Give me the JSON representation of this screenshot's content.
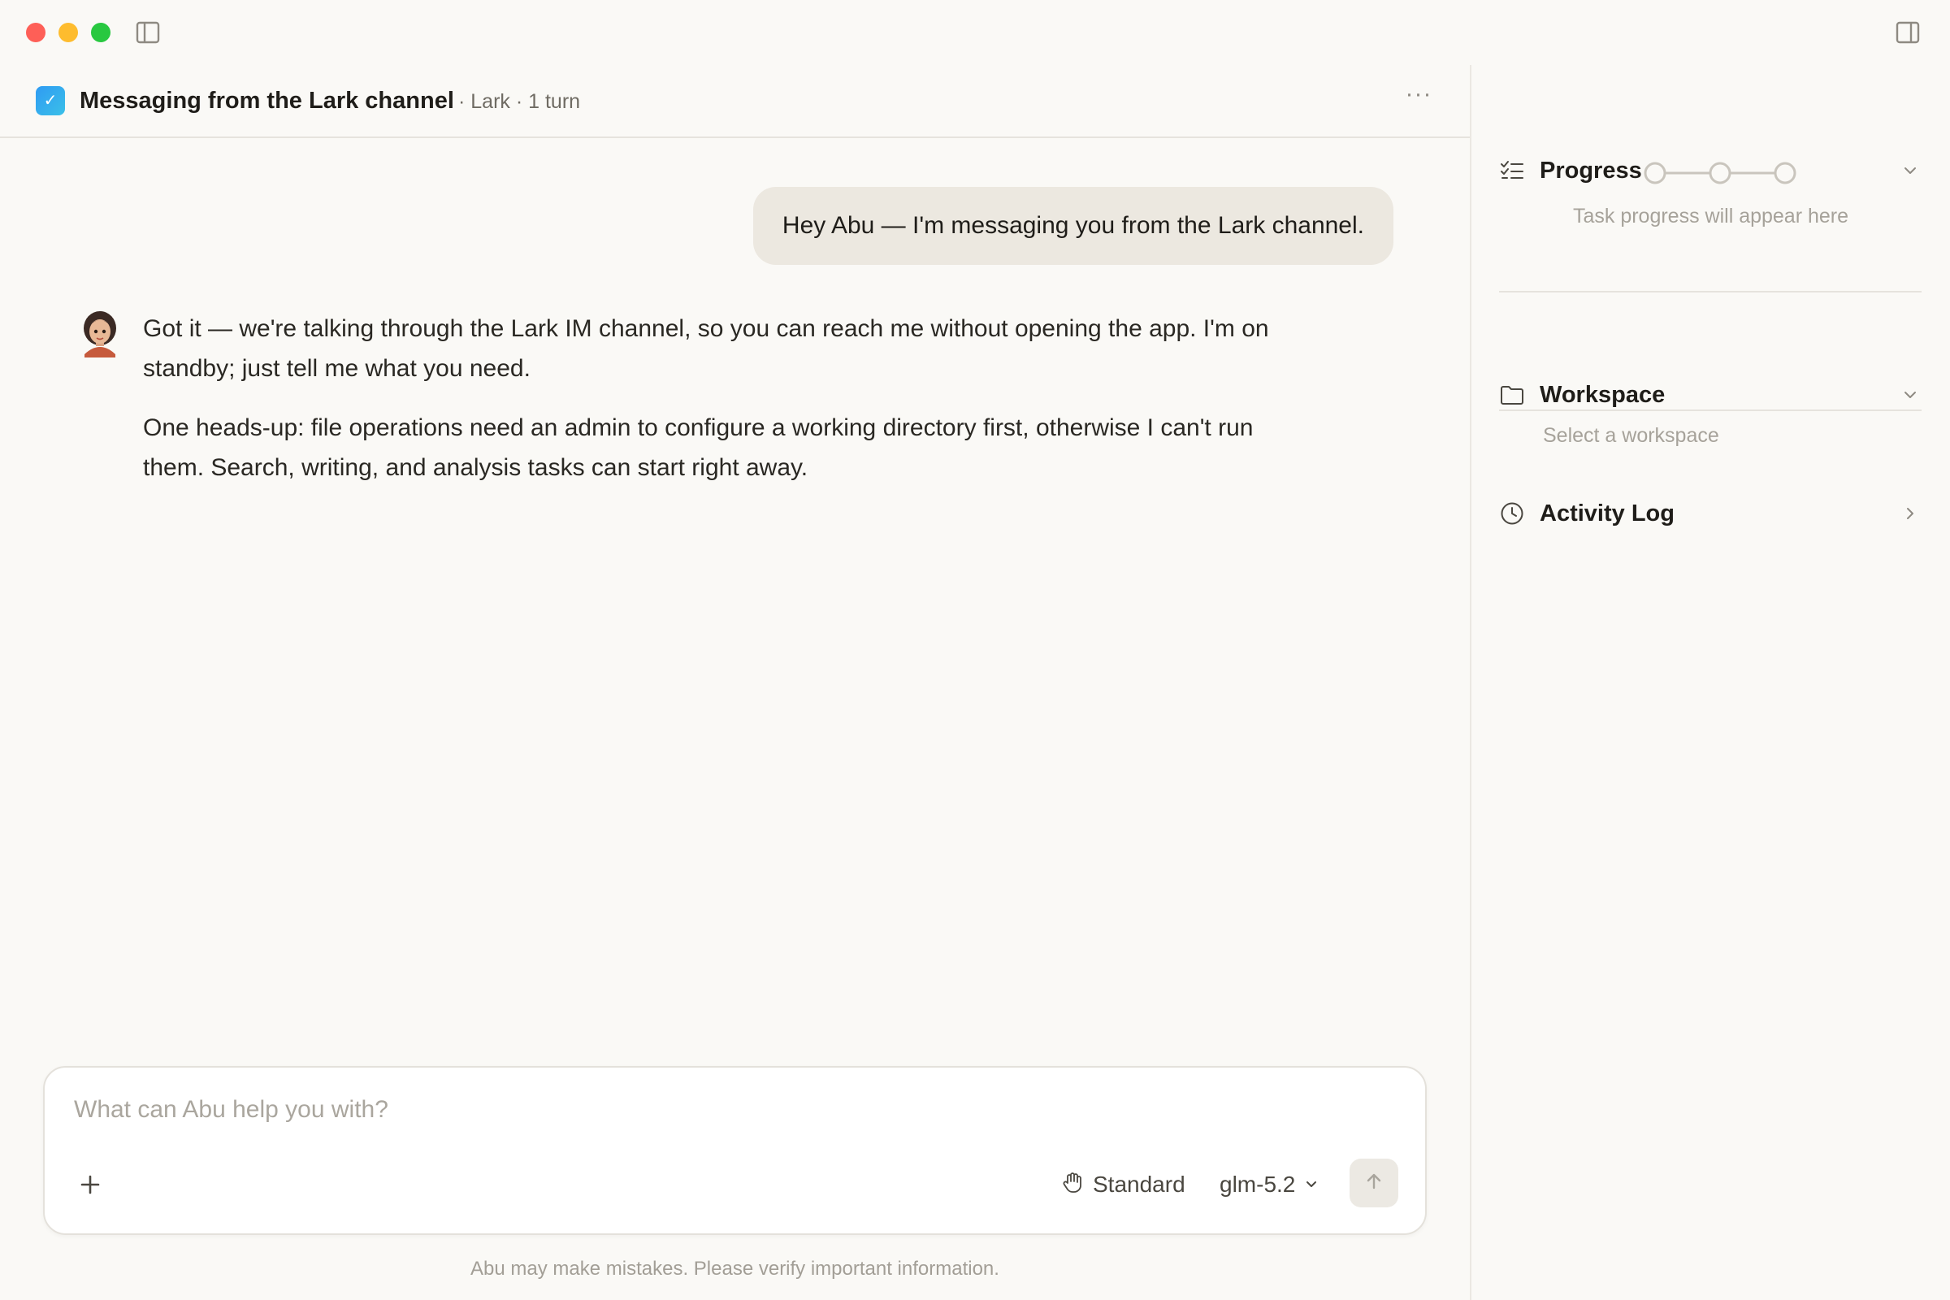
{
  "conversation": {
    "title": "Messaging from the Lark channel",
    "meta": "· Lark · 1 turn",
    "more": "···"
  },
  "messages": {
    "user": "Hey Abu — I'm messaging you from the Lark channel.",
    "assistant_p1": "Got it — we're talking through the Lark IM channel, so you can reach me without opening the app. I'm on standby; just tell me what you need.",
    "assistant_p2": "One heads-up: file operations need an admin to configure a working directory first, otherwise I can't run them. Search, writing, and analysis tasks can start right away."
  },
  "composer": {
    "placeholder": "What can Abu help you with?",
    "mode_label": "Standard",
    "model_label": "glm-5.2"
  },
  "disclaimer": "Abu may make mistakes. Please verify important information.",
  "right_panel": {
    "progress_title": "Progress",
    "progress_empty": "Task progress will appear here",
    "workspace_title": "Workspace",
    "workspace_placeholder": "Select a workspace",
    "activity_title": "Activity Log"
  },
  "icons": {
    "window_controls": [
      "close",
      "minimize",
      "zoom"
    ],
    "sidebar_toggle": "sidebar-left-icon",
    "panel_toggle": "sidebar-right-icon",
    "app": "lark-app-icon",
    "avatar": "assistant-avatar"
  },
  "colors": {
    "background": "#faf9f6",
    "user_bubble": "#ece8e0",
    "close": "#fe5f57",
    "minimize": "#febc2e",
    "zoom": "#28c840",
    "app_icon": "#2f9bf3"
  }
}
